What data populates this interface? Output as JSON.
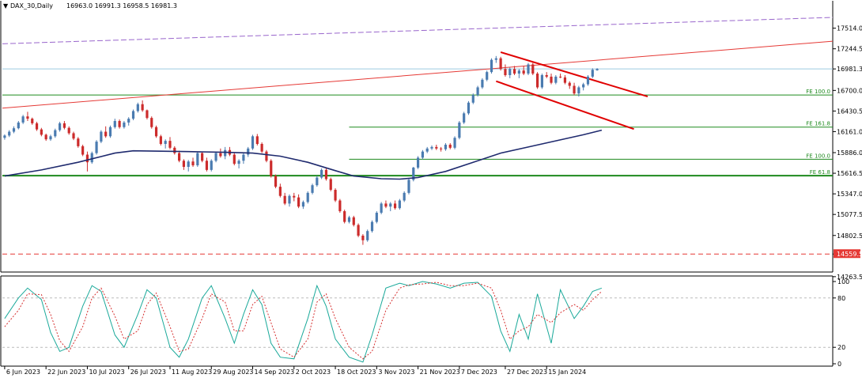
{
  "header": {
    "symbol": "DAX_30,Daily",
    "ohlc": "16963.0 16991.3 16958.5 16981.3"
  },
  "chart_data": {
    "type": "candlestick",
    "price_axis": {
      "ticks": [
        "17514.0",
        "17244.5",
        "16981.3",
        "16700.0",
        "16430.5",
        "16161.0",
        "15886.0",
        "15616.5",
        "15347.0",
        "15077.5",
        "14802.5",
        "14559.5",
        "14263.5"
      ],
      "range": [
        14200,
        17800
      ]
    },
    "current_price": {
      "value": 16981.3,
      "label": "16981.3"
    },
    "support_line": {
      "value": 14559.5,
      "label": "14559.5"
    },
    "x_axis_labels": [
      "6 Jun 2023",
      "22 Jun 2023",
      "10 Jul 2023",
      "26 Jul 2023",
      "11 Aug 2023",
      "29 Aug 2023",
      "14 Sep 2023",
      "2 Oct 2023",
      "18 Oct 2023",
      "3 Nov 2023",
      "21 Nov 2023",
      "7 Dec 2023",
      "27 Dec 2023",
      "15 Jan 2024"
    ],
    "fib_levels": [
      {
        "label": "FE 100.0",
        "value": 16640,
        "start_index": 0
      },
      {
        "label": "FE 161.8",
        "value": 16220,
        "start_index": 75
      },
      {
        "label": "FE 100.0",
        "value": 15800,
        "start_index": 75
      },
      {
        "label": "FE 61.8",
        "value": 15585,
        "start_index": 0
      }
    ],
    "colors": {
      "up": "#4a7bb0",
      "down": "#cc2b2b",
      "ma": "#1f2a6e",
      "fib": "#1e8a1e",
      "trend": "#e53935",
      "channel": "#e00000",
      "purple": "#9966cc",
      "k_line": "#1aa99a",
      "d_line": "#d63030"
    },
    "candles": [
      [
        16080,
        16125,
        16055,
        16110
      ],
      [
        16110,
        16180,
        16090,
        16160
      ],
      [
        16160,
        16230,
        16140,
        16205
      ],
      [
        16205,
        16300,
        16190,
        16280
      ],
      [
        16280,
        16380,
        16260,
        16360
      ],
      [
        16360,
        16420,
        16300,
        16330
      ],
      [
        16330,
        16345,
        16250,
        16270
      ],
      [
        16270,
        16290,
        16170,
        16190
      ],
      [
        16190,
        16210,
        16100,
        16120
      ],
      [
        16120,
        16135,
        16040,
        16060
      ],
      [
        16060,
        16120,
        16040,
        16100
      ],
      [
        16100,
        16200,
        16080,
        16180
      ],
      [
        16180,
        16290,
        16160,
        16270
      ],
      [
        16270,
        16300,
        16190,
        16210
      ],
      [
        16210,
        16230,
        16120,
        16140
      ],
      [
        16140,
        16160,
        16050,
        16070
      ],
      [
        16070,
        16090,
        15950,
        15970
      ],
      [
        15970,
        15990,
        15840,
        15860
      ],
      [
        15860,
        15900,
        15640,
        15760
      ],
      [
        15760,
        15900,
        15740,
        15880
      ],
      [
        15880,
        16050,
        15860,
        16030
      ],
      [
        16030,
        16180,
        16010,
        16160
      ],
      [
        16160,
        16230,
        16080,
        16100
      ],
      [
        16100,
        16240,
        16080,
        16220
      ],
      [
        16220,
        16330,
        16200,
        16300
      ],
      [
        16300,
        16320,
        16200,
        16220
      ],
      [
        16220,
        16300,
        16200,
        16280
      ],
      [
        16280,
        16350,
        16240,
        16330
      ],
      [
        16330,
        16450,
        16310,
        16430
      ],
      [
        16430,
        16540,
        16410,
        16520
      ],
      [
        16520,
        16570,
        16420,
        16440
      ],
      [
        16440,
        16450,
        16320,
        16340
      ],
      [
        16340,
        16360,
        16200,
        16220
      ],
      [
        16220,
        16240,
        16080,
        16100
      ],
      [
        16100,
        16120,
        15980,
        16000
      ],
      [
        16000,
        16060,
        15940,
        16040
      ],
      [
        16040,
        16090,
        15930,
        15950
      ],
      [
        15950,
        15970,
        15860,
        15880
      ],
      [
        15880,
        15910,
        15760,
        15780
      ],
      [
        15780,
        15800,
        15660,
        15700
      ],
      [
        15700,
        15790,
        15640,
        15770
      ],
      [
        15770,
        15820,
        15700,
        15720
      ],
      [
        15720,
        15900,
        15700,
        15880
      ],
      [
        15880,
        15900,
        15760,
        15780
      ],
      [
        15780,
        15820,
        15640,
        15660
      ],
      [
        15660,
        15800,
        15640,
        15780
      ],
      [
        15780,
        15900,
        15760,
        15880
      ],
      [
        15880,
        15940,
        15820,
        15840
      ],
      [
        15840,
        15960,
        15800,
        15920
      ],
      [
        15920,
        15960,
        15840,
        15860
      ],
      [
        15860,
        15880,
        15720,
        15740
      ],
      [
        15740,
        15800,
        15680,
        15780
      ],
      [
        15780,
        15880,
        15740,
        15860
      ],
      [
        15860,
        15960,
        15830,
        15940
      ],
      [
        15940,
        16120,
        15920,
        16100
      ],
      [
        16100,
        16130,
        15980,
        16000
      ],
      [
        16000,
        16020,
        15880,
        15900
      ],
      [
        15900,
        15920,
        15760,
        15780
      ],
      [
        15780,
        15800,
        15560,
        15580
      ],
      [
        15580,
        15600,
        15420,
        15440
      ],
      [
        15440,
        15480,
        15300,
        15320
      ],
      [
        15320,
        15360,
        15200,
        15220
      ],
      [
        15220,
        15340,
        15180,
        15320
      ],
      [
        15320,
        15360,
        15250,
        15300
      ],
      [
        15300,
        15340,
        15160,
        15180
      ],
      [
        15180,
        15260,
        15150,
        15240
      ],
      [
        15240,
        15380,
        15220,
        15360
      ],
      [
        15360,
        15480,
        15340,
        15460
      ],
      [
        15460,
        15580,
        15440,
        15560
      ],
      [
        15560,
        15680,
        15540,
        15660
      ],
      [
        15660,
        15680,
        15520,
        15540
      ],
      [
        15540,
        15560,
        15380,
        15400
      ],
      [
        15400,
        15420,
        15240,
        15260
      ],
      [
        15260,
        15280,
        15100,
        15120
      ],
      [
        15120,
        15140,
        14960,
        14980
      ],
      [
        14980,
        15060,
        14960,
        15040
      ],
      [
        15040,
        15060,
        14920,
        14940
      ],
      [
        14940,
        14960,
        14780,
        14800
      ],
      [
        14800,
        14820,
        14680,
        14740
      ],
      [
        14740,
        14880,
        14720,
        14860
      ],
      [
        14860,
        15000,
        14840,
        14980
      ],
      [
        14980,
        15120,
        14960,
        15100
      ],
      [
        15100,
        15240,
        15080,
        15220
      ],
      [
        15220,
        15260,
        15160,
        15180
      ],
      [
        15180,
        15240,
        15120,
        15220
      ],
      [
        15220,
        15260,
        15140,
        15160
      ],
      [
        15160,
        15280,
        15140,
        15260
      ],
      [
        15260,
        15380,
        15240,
        15360
      ],
      [
        15360,
        15550,
        15340,
        15530
      ],
      [
        15530,
        15700,
        15510,
        15690
      ],
      [
        15690,
        15840,
        15670,
        15820
      ],
      [
        15820,
        15920,
        15800,
        15900
      ],
      [
        15900,
        15960,
        15880,
        15940
      ],
      [
        15940,
        15980,
        15920,
        15960
      ],
      [
        15960,
        15990,
        15920,
        15940
      ],
      [
        15940,
        15960,
        15900,
        15930
      ],
      [
        15930,
        16010,
        15910,
        15990
      ],
      [
        15990,
        16010,
        15930,
        15950
      ],
      [
        15950,
        16100,
        15930,
        16080
      ],
      [
        16080,
        16300,
        16060,
        16280
      ],
      [
        16280,
        16420,
        16260,
        16400
      ],
      [
        16400,
        16560,
        16380,
        16540
      ],
      [
        16540,
        16660,
        16520,
        16640
      ],
      [
        16640,
        16760,
        16620,
        16740
      ],
      [
        16740,
        16860,
        16720,
        16840
      ],
      [
        16840,
        16960,
        16820,
        16940
      ],
      [
        16940,
        17120,
        16920,
        17100
      ],
      [
        17100,
        17150,
        17060,
        17120
      ],
      [
        17120,
        17140,
        16960,
        16980
      ],
      [
        16980,
        17040,
        16880,
        16900
      ],
      [
        16900,
        17000,
        16860,
        16980
      ],
      [
        16980,
        17020,
        16900,
        16920
      ],
      [
        16920,
        16980,
        16860,
        16960
      ],
      [
        16960,
        17020,
        16900,
        16920
      ],
      [
        16920,
        17060,
        16900,
        17040
      ],
      [
        17040,
        17060,
        16900,
        16920
      ],
      [
        16920,
        16940,
        16720,
        16740
      ],
      [
        16740,
        16920,
        16720,
        16900
      ],
      [
        16900,
        16940,
        16860,
        16880
      ],
      [
        16880,
        16920,
        16780,
        16800
      ],
      [
        16800,
        16900,
        16780,
        16880
      ],
      [
        16880,
        16920,
        16860,
        16870
      ],
      [
        16870,
        16900,
        16780,
        16800
      ],
      [
        16800,
        16820,
        16720,
        16760
      ],
      [
        16760,
        16800,
        16640,
        16660
      ],
      [
        16660,
        16760,
        16620,
        16740
      ],
      [
        16740,
        16800,
        16700,
        16780
      ],
      [
        16780,
        16900,
        16760,
        16880
      ],
      [
        16880,
        16990,
        16860,
        16970
      ],
      [
        16963,
        16991,
        16958,
        16981
      ]
    ],
    "ma": [
      [
        0,
        15580
      ],
      [
        8,
        15660
      ],
      [
        16,
        15760
      ],
      [
        24,
        15880
      ],
      [
        28,
        15910
      ],
      [
        34,
        15905
      ],
      [
        40,
        15900
      ],
      [
        48,
        15890
      ],
      [
        54,
        15880
      ],
      [
        60,
        15840
      ],
      [
        66,
        15760
      ],
      [
        72,
        15650
      ],
      [
        76,
        15580
      ],
      [
        82,
        15545
      ],
      [
        86,
        15540
      ],
      [
        90,
        15560
      ],
      [
        96,
        15640
      ],
      [
        102,
        15760
      ],
      [
        108,
        15880
      ],
      [
        114,
        15960
      ],
      [
        120,
        16040
      ],
      [
        126,
        16120
      ],
      [
        130,
        16180
      ]
    ],
    "stochastic": {
      "levels": [
        100,
        80,
        20,
        0
      ],
      "k": [
        [
          0,
          55
        ],
        [
          3,
          80
        ],
        [
          5,
          92
        ],
        [
          8,
          78
        ],
        [
          10,
          38
        ],
        [
          12,
          15
        ],
        [
          14,
          20
        ],
        [
          17,
          70
        ],
        [
          19,
          95
        ],
        [
          21,
          88
        ],
        [
          24,
          35
        ],
        [
          26,
          20
        ],
        [
          29,
          60
        ],
        [
          31,
          90
        ],
        [
          33,
          80
        ],
        [
          36,
          20
        ],
        [
          38,
          8
        ],
        [
          40,
          30
        ],
        [
          43,
          80
        ],
        [
          45,
          95
        ],
        [
          48,
          55
        ],
        [
          50,
          25
        ],
        [
          52,
          60
        ],
        [
          54,
          90
        ],
        [
          56,
          72
        ],
        [
          58,
          25
        ],
        [
          60,
          8
        ],
        [
          63,
          6
        ],
        [
          66,
          55
        ],
        [
          68,
          95
        ],
        [
          70,
          70
        ],
        [
          72,
          30
        ],
        [
          75,
          8
        ],
        [
          78,
          2
        ],
        [
          80,
          35
        ],
        [
          83,
          92
        ],
        [
          86,
          98
        ],
        [
          88,
          95
        ],
        [
          91,
          100
        ],
        [
          94,
          97
        ],
        [
          97,
          92
        ],
        [
          100,
          98
        ],
        [
          103,
          99
        ],
        [
          106,
          82
        ],
        [
          108,
          40
        ],
        [
          110,
          15
        ],
        [
          112,
          60
        ],
        [
          114,
          30
        ],
        [
          116,
          85
        ],
        [
          119,
          25
        ],
        [
          121,
          90
        ],
        [
          124,
          55
        ],
        [
          126,
          70
        ],
        [
          128,
          88
        ],
        [
          130,
          92
        ]
      ],
      "d": [
        [
          0,
          45
        ],
        [
          3,
          65
        ],
        [
          5,
          85
        ],
        [
          8,
          84
        ],
        [
          10,
          60
        ],
        [
          12,
          28
        ],
        [
          14,
          15
        ],
        [
          17,
          45
        ],
        [
          19,
          80
        ],
        [
          21,
          92
        ],
        [
          24,
          58
        ],
        [
          26,
          30
        ],
        [
          29,
          40
        ],
        [
          31,
          72
        ],
        [
          33,
          86
        ],
        [
          36,
          45
        ],
        [
          38,
          15
        ],
        [
          40,
          18
        ],
        [
          43,
          55
        ],
        [
          45,
          85
        ],
        [
          48,
          75
        ],
        [
          50,
          40
        ],
        [
          52,
          40
        ],
        [
          54,
          72
        ],
        [
          56,
          82
        ],
        [
          58,
          50
        ],
        [
          60,
          18
        ],
        [
          63,
          8
        ],
        [
          66,
          30
        ],
        [
          68,
          75
        ],
        [
          70,
          85
        ],
        [
          72,
          55
        ],
        [
          75,
          20
        ],
        [
          78,
          6
        ],
        [
          80,
          15
        ],
        [
          83,
          65
        ],
        [
          86,
          92
        ],
        [
          88,
          96
        ],
        [
          91,
          97
        ],
        [
          94,
          99
        ],
        [
          97,
          95
        ],
        [
          100,
          95
        ],
        [
          103,
          98
        ],
        [
          106,
          92
        ],
        [
          108,
          65
        ],
        [
          110,
          30
        ],
        [
          112,
          40
        ],
        [
          114,
          45
        ],
        [
          116,
          60
        ],
        [
          119,
          50
        ],
        [
          121,
          62
        ],
        [
          124,
          72
        ],
        [
          126,
          65
        ],
        [
          128,
          78
        ],
        [
          130,
          88
        ]
      ]
    }
  }
}
